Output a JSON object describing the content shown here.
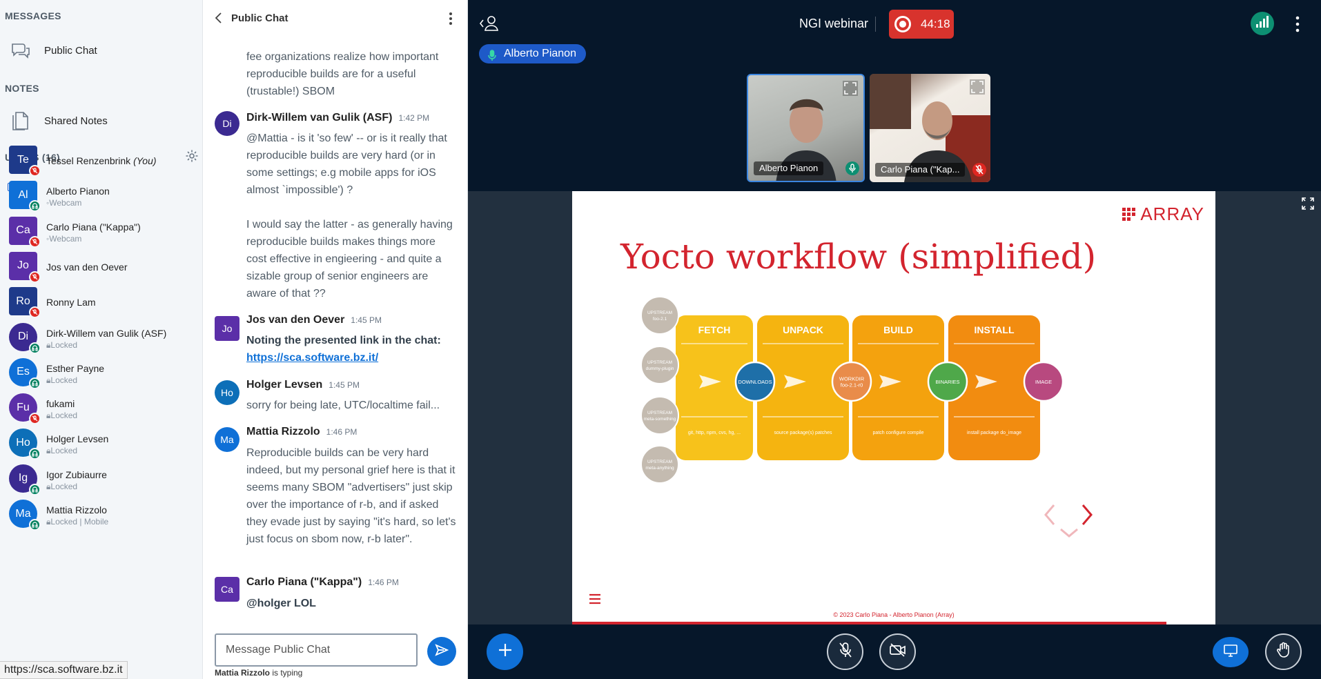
{
  "sidebar": {
    "messages_header": "MESSAGES",
    "public_chat_label": "Public Chat",
    "notes_header": "NOTES",
    "shared_notes_label": "Shared Notes",
    "users_header": "USERS (16)",
    "users": [
      {
        "initials": "Te",
        "name": "Tessel Renzenbrink",
        "you": "(You)",
        "sub": "",
        "color": "#1e3a8a",
        "badge": "red"
      },
      {
        "initials": "Al",
        "name": "Alberto Pianon",
        "sub": "Webcam",
        "color": "#0f70d7",
        "badge": "green"
      },
      {
        "initials": "Ca",
        "name": "Carlo Piana (\"Kappa\")",
        "sub": "Webcam",
        "color": "#5b2fa8",
        "badge": "red"
      },
      {
        "initials": "Jo",
        "name": "Jos van den Oever",
        "sub": "",
        "color": "#5b2fa8",
        "badge": "red"
      },
      {
        "initials": "Ro",
        "name": "Ronny Lam",
        "sub": "",
        "color": "#1e3a8a",
        "badge": "red"
      },
      {
        "initials": "Di",
        "name": "Dirk-Willem van Gulik (ASF)",
        "sub": "Locked",
        "color": "#3b2a91",
        "badge": "green"
      },
      {
        "initials": "Es",
        "name": "Esther Payne",
        "sub": "Locked",
        "color": "#0f70d7",
        "badge": "green"
      },
      {
        "initials": "Fu",
        "name": "fukami",
        "sub": "Locked",
        "color": "#5b2fa8",
        "badge": "red"
      },
      {
        "initials": "Ho",
        "name": "Holger Levsen",
        "sub": "Locked",
        "color": "#0d6fb8",
        "badge": "green"
      },
      {
        "initials": "Ig",
        "name": "Igor Zubiaurre",
        "sub": "Locked",
        "color": "#3b2a91",
        "badge": "green"
      },
      {
        "initials": "Ma",
        "name": "Mattia Rizzolo",
        "sub": "Locked | Mobile",
        "color": "#0f70d7",
        "badge": "green"
      }
    ]
  },
  "status_url": "https://sca.software.bz.it",
  "chat": {
    "title": "Public Chat",
    "partial_message": "fee organizations realize how important reproducible builds are for a useful (trustable!) SBOM",
    "messages": [
      {
        "initials": "Di",
        "author": "Dirk-Willem van Gulik (ASF)",
        "time": "1:42 PM",
        "color": "#3b2a91",
        "text": "@Mattia - is it 'so few' -- or is it really that reproducible builds are very hard (or in some settings; e.g mobile apps for iOS almost `impossible') ?",
        "text2": "I would say the latter - as generally having reproducible builds makes things more cost effective in engieering - and quite a sizable group of senior engineers are aware of that ??"
      },
      {
        "initials": "Jo",
        "author": "Jos van den Oever",
        "time": "1:45 PM",
        "color": "#5b2fa8",
        "text": "Noting the presented link in the chat:",
        "link": "https://sca.software.bz.it/"
      },
      {
        "initials": "Ho",
        "author": "Holger Levsen",
        "time": "1:45 PM",
        "color": "#0d6fb8",
        "text": "sorry for being late, UTC/localtime fail..."
      },
      {
        "initials": "Ma",
        "author": "Mattia Rizzolo",
        "time": "1:46 PM",
        "color": "#0f70d7",
        "text": "Reproducible builds can be very hard indeed, but my personal grief here is that it seems many SBOM \"advertisers\" just skip over the importance of r-b, and if asked they evade just by saying \"it's hard, so let's just focus on sbom now, r-b later\"."
      },
      {
        "initials": "Ca",
        "author": "Carlo Piana (\"Kappa\")",
        "time": "1:46 PM",
        "color": "#5b2fa8",
        "text": "@holger LOL"
      }
    ],
    "input_placeholder": "Message Public Chat",
    "typing_user": "Mattia Rizzolo",
    "typing_suffix": " is typing"
  },
  "main": {
    "meeting_title": "NGI webinar",
    "recording_time": "44:18",
    "talker": "Alberto Pianon",
    "videos": [
      {
        "name": "Alberto Pianon"
      },
      {
        "name": "Carlo Piana (\"Kap..."
      }
    ],
    "slide": {
      "logo": "ARRAY",
      "title": "Yocto workflow (simplified)",
      "stages": [
        {
          "name": "FETCH",
          "note": "git, http, npm, cvs, hg, ...",
          "color": "#f7c21b"
        },
        {
          "name": "UNPACK",
          "note": "source package(s) patches",
          "color": "#f5b410"
        },
        {
          "name": "BUILD",
          "note": "patch configure compile",
          "color": "#f4a20e"
        },
        {
          "name": "INSTALL",
          "note": "install package do_image",
          "color": "#f28c10"
        }
      ],
      "upstreams": [
        "UPSTREAM foo-2.1",
        "UPSTREAM dummy-plugin",
        "UPSTREAM meta-something",
        "UPSTREAM meta-anything"
      ],
      "nodes": [
        {
          "label": "DOWNLOADS",
          "color": "#1e6fa8"
        },
        {
          "label": "WORKDIR foo-2.1-r0",
          "color": "#e98c4a"
        },
        {
          "label": "BINARIES",
          "color": "#4fa84a"
        },
        {
          "label": "IMAGE",
          "color": "#b8497f"
        }
      ],
      "footer": "© 2023 Carlo Piana - Alberto Pianon (Array)"
    }
  }
}
